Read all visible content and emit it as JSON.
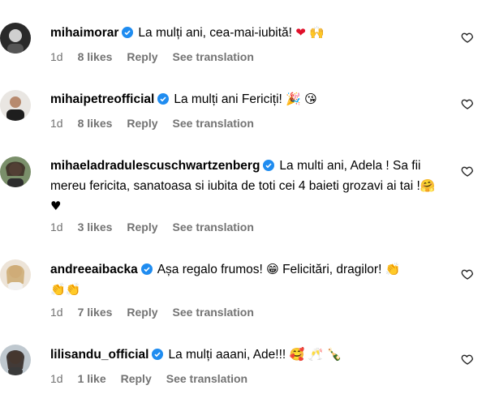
{
  "colors": {
    "verified": "#1f8cf0",
    "meta_text": "#737373",
    "heart": "#e0102a"
  },
  "comments": [
    {
      "username": "mihaimorar",
      "text": "La mulți ani, cea-mai-iubită!",
      "emojis": [
        "❤",
        "🙌"
      ],
      "time": "1d",
      "likes": "8 likes",
      "reply": "Reply",
      "see_translation": "See translation"
    },
    {
      "username": "mihaipetreofficial",
      "text": "La mulți ani Fericiți!",
      "emojis": [
        "🎉",
        "😘"
      ],
      "time": "1d",
      "likes": "8 likes",
      "reply": "Reply",
      "see_translation": "See translation"
    },
    {
      "username": "mihaeladradulescuschwartzenberg",
      "text": "La multi ani, Adela ! Sa fii mereu fericita, sanatoasa si iubita de toti cei 4 baieti grozavi ai tai !",
      "emojis": [
        "🤗",
        "♥"
      ],
      "time": "1d",
      "likes": "3 likes",
      "reply": "Reply",
      "see_translation": "See translation"
    },
    {
      "username": "andreeaibacka",
      "text": "Așa regalo frumos!",
      "emojis": [
        "😁"
      ],
      "text2": "Felicitări, dragilor!",
      "emojis2": [
        "👏",
        "👏",
        "👏"
      ],
      "time": "1d",
      "likes": "7 likes",
      "reply": "Reply",
      "see_translation": "See translation"
    },
    {
      "username": "lilisandu_official",
      "text": "La mulți aaani, Ade!!!",
      "emojis": [
        "🥰",
        "🥂",
        "🍾"
      ],
      "time": "1d",
      "likes": "1 like",
      "reply": "Reply",
      "see_translation": "See translation"
    }
  ]
}
